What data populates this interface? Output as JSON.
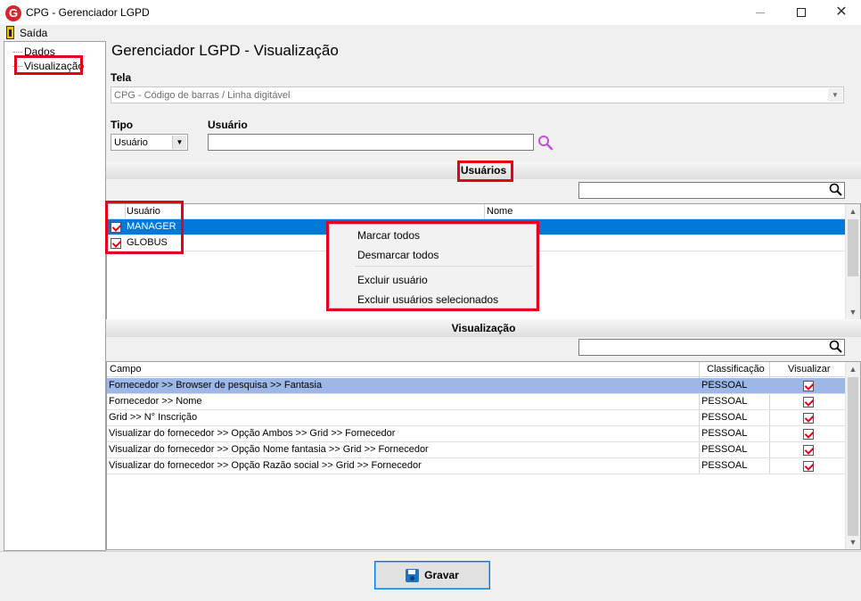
{
  "window": {
    "app_logo": "G",
    "title": "CPG - Gerenciador LGPD",
    "minimize_glyph": "",
    "close_glyph": "✕"
  },
  "menu": {
    "exit_label": "Saída"
  },
  "tree": {
    "items": [
      "Dados",
      "Visualização"
    ]
  },
  "page_title": "Gerenciador LGPD - Visualização",
  "tela": {
    "label": "Tela",
    "value": "CPG - Código de barras / Linha digitável"
  },
  "tipo": {
    "label": "Tipo",
    "value": "Usuário"
  },
  "usuario_filter": {
    "label": "Usuário",
    "value": ""
  },
  "users_section": {
    "title": "Usuários",
    "search_value": "",
    "columns": [
      "Usuário",
      "Nome"
    ],
    "rows": [
      {
        "usuario": "MANAGER",
        "nome": "",
        "checked": true,
        "selected": true
      },
      {
        "usuario": "GLOBUS",
        "nome": "",
        "checked": true,
        "selected": false
      }
    ]
  },
  "context_menu": {
    "items": [
      "Marcar todos",
      "Desmarcar todos",
      "Excluir usuário",
      "Excluir usuários selecionados"
    ]
  },
  "vis_section": {
    "title": "Visualização",
    "search_value": "",
    "columns": [
      "Campo",
      "Classificação",
      "Visualizar"
    ],
    "rows": [
      {
        "campo": "Fornecedor >> Browser de pesquisa >> Fantasia",
        "classificacao": "PESSOAL",
        "visualizar": true
      },
      {
        "campo": "Fornecedor >> Nome",
        "classificacao": "PESSOAL",
        "visualizar": true
      },
      {
        "campo": "Grid >> N° Inscrição",
        "classificacao": "PESSOAL",
        "visualizar": true
      },
      {
        "campo": "Visualizar do fornecedor >> Opção Ambos  >> Grid >> Fornecedor",
        "classificacao": "PESSOAL",
        "visualizar": true
      },
      {
        "campo": "Visualizar do fornecedor >> Opção Nome fantasia >> Grid >> Fornecedor",
        "classificacao": "PESSOAL",
        "visualizar": true
      },
      {
        "campo": "Visualizar do fornecedor >> Opção Razão social >> Grid >> Fornecedor",
        "classificacao": "PESSOAL",
        "visualizar": true
      }
    ]
  },
  "save_button": {
    "label": "Gravar"
  },
  "colors": {
    "highlight": "#e3001b",
    "selection": "#0078d7",
    "row_selected": "#9db8e6",
    "search_icon": "#c44fd6"
  }
}
